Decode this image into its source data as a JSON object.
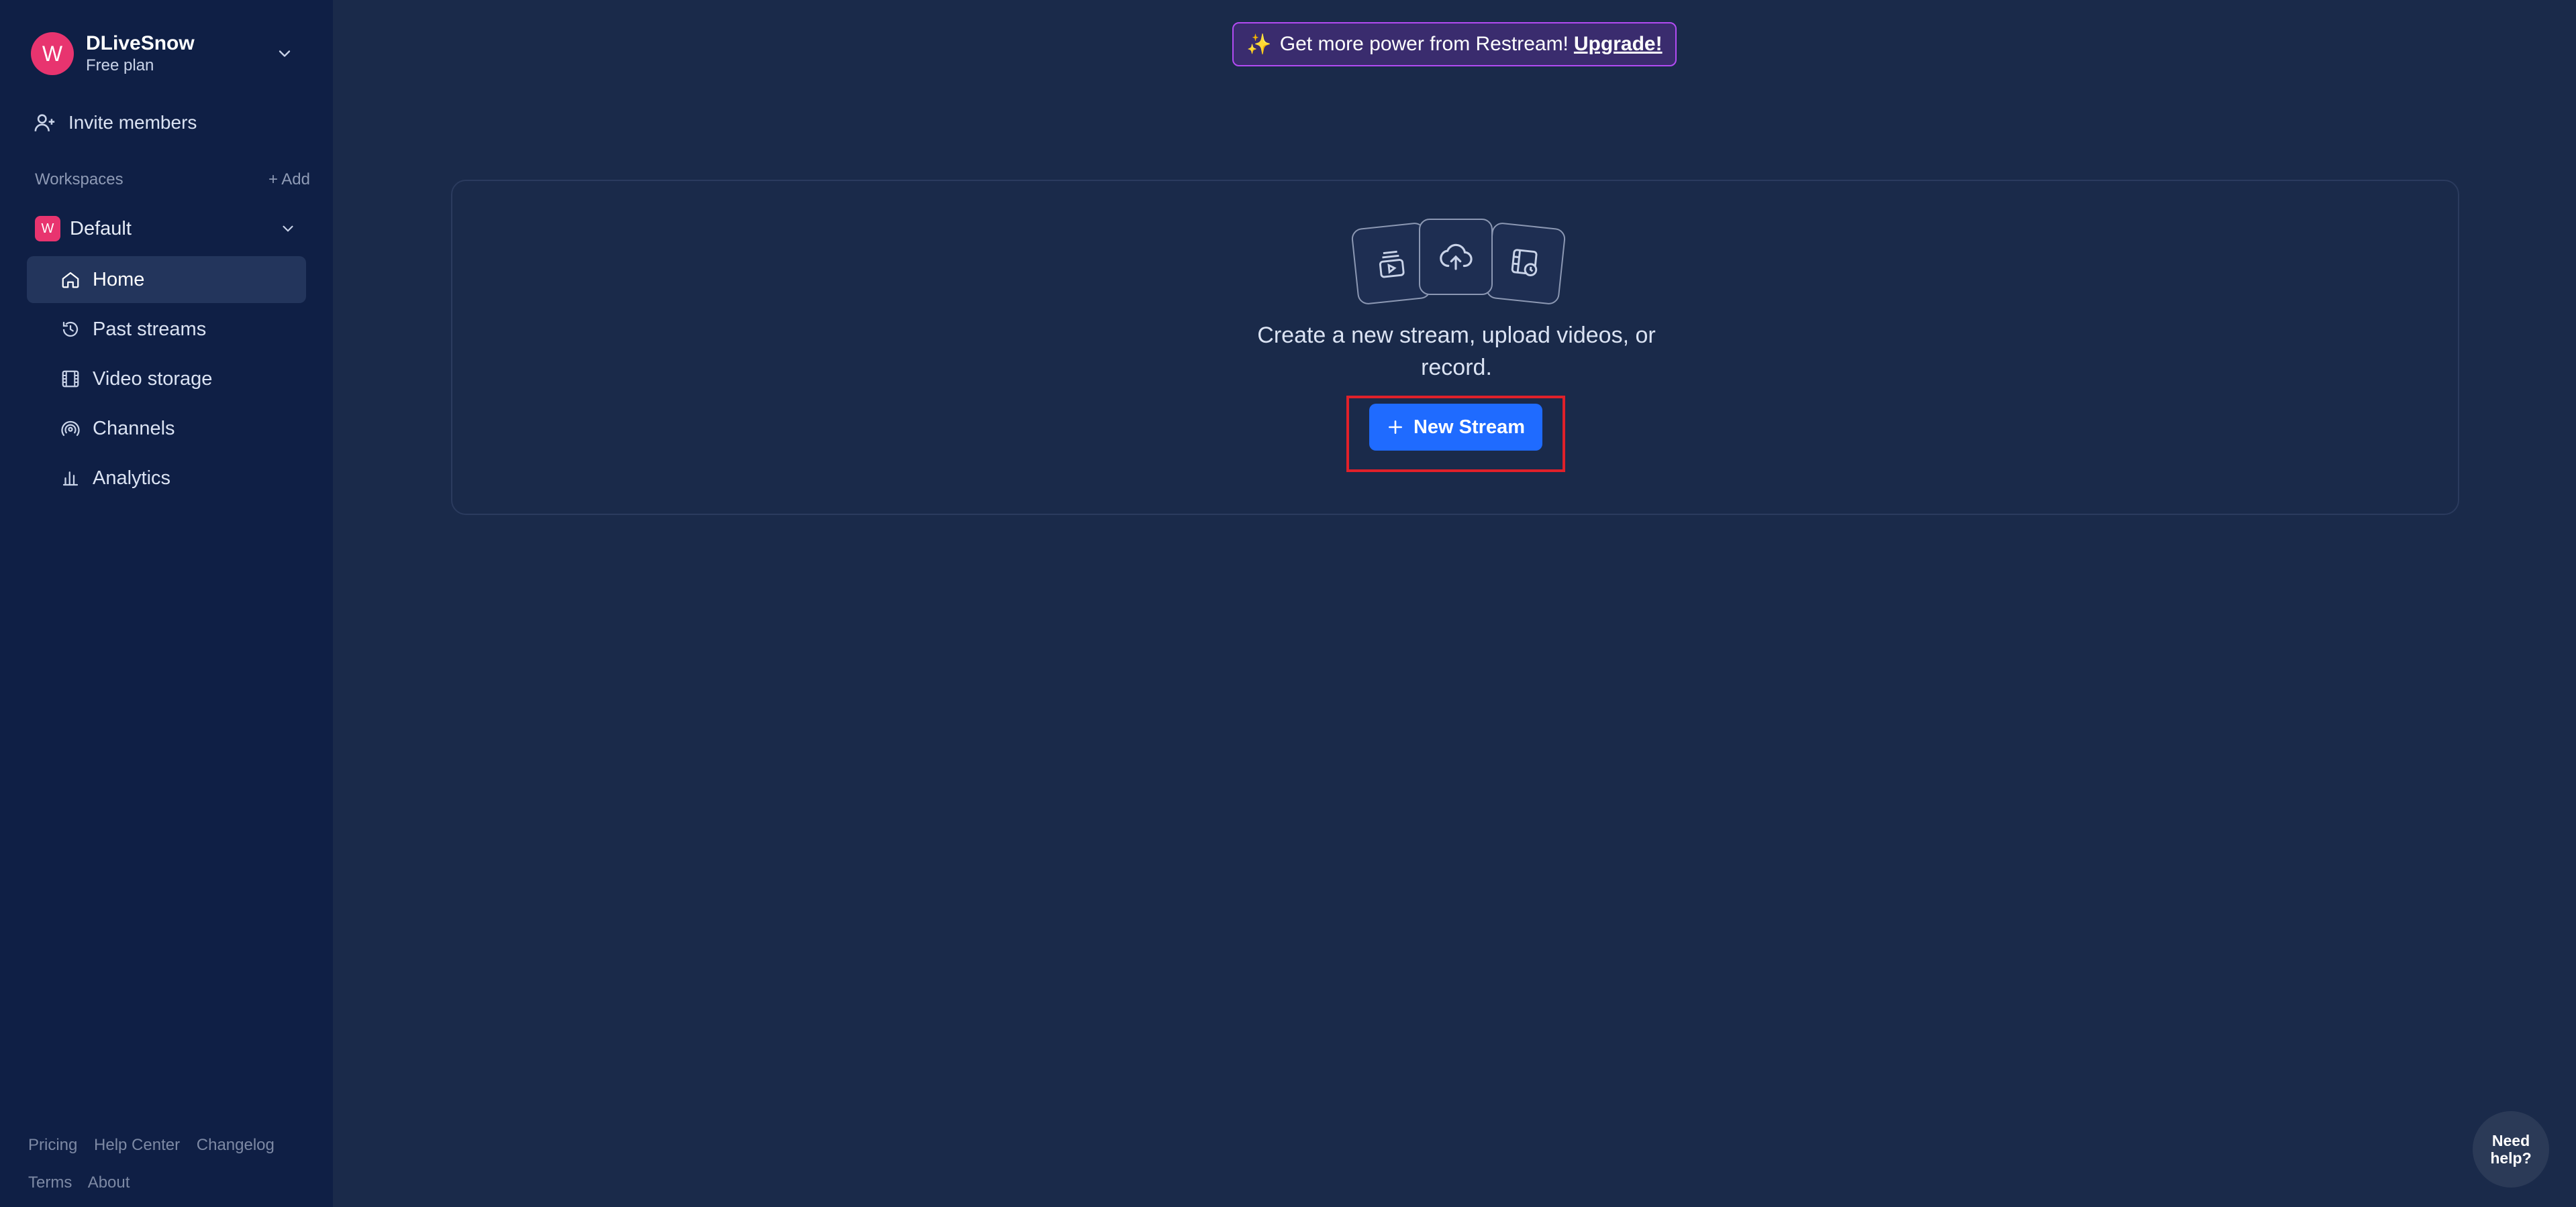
{
  "user": {
    "initial": "W",
    "name": "DLiveSnow",
    "plan": "Free plan"
  },
  "invite": {
    "label": "Invite members"
  },
  "workspaces": {
    "heading": "Workspaces",
    "add_label": "+ Add",
    "current": {
      "badge": "W",
      "name": "Default"
    }
  },
  "nav": [
    {
      "label": "Home",
      "icon": "home-icon",
      "active": true
    },
    {
      "label": "Past streams",
      "icon": "history-icon"
    },
    {
      "label": "Video storage",
      "icon": "film-icon"
    },
    {
      "label": "Channels",
      "icon": "broadcast-icon"
    },
    {
      "label": "Analytics",
      "icon": "bar-chart-icon"
    }
  ],
  "footer": {
    "links_row1": [
      "Pricing",
      "Help Center",
      "Changelog"
    ],
    "links_row2": [
      "Terms",
      "About"
    ]
  },
  "banner": {
    "emoji": "✨",
    "text": "Get more power from Restream!",
    "link": "Upgrade!"
  },
  "card": {
    "description": "Create a new stream, upload videos, or record.",
    "button": "New Stream"
  },
  "help": {
    "label_line1": "Need",
    "label_line2": "help?"
  },
  "colors": {
    "accent": "#1f6bff",
    "brand_pink": "#e8346f",
    "sidebar_bg": "#0f1f45",
    "main_bg": "#1a2a4a",
    "highlight": "#e0202a"
  }
}
